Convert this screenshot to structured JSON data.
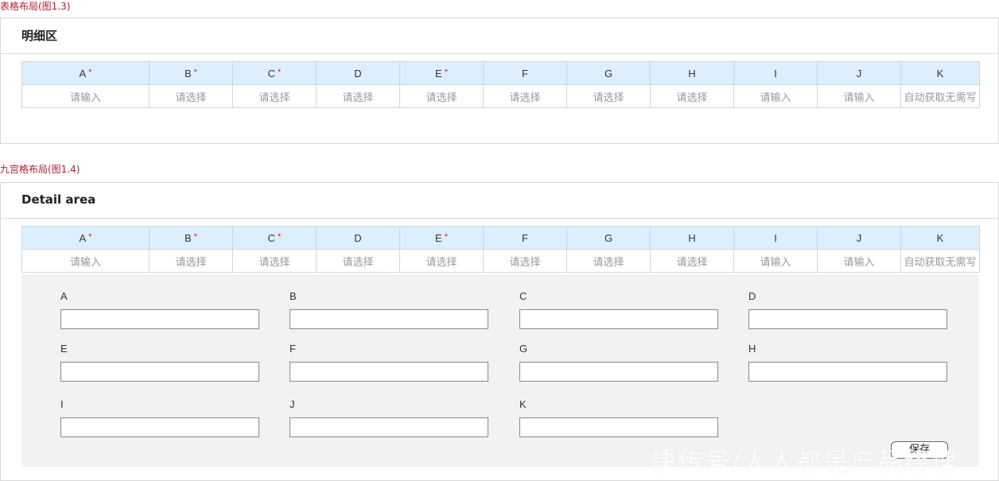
{
  "captions": {
    "table_layout": "表格布局(图1.3)",
    "grid_layout": "九宫格布局(图1.4)"
  },
  "panel1": {
    "title": "明细区"
  },
  "panel2": {
    "title": "Detail area"
  },
  "columns": [
    {
      "label": "A",
      "required": true
    },
    {
      "label": "B",
      "required": true
    },
    {
      "label": "C",
      "required": true
    },
    {
      "label": "D",
      "required": false
    },
    {
      "label": "E",
      "required": true
    },
    {
      "label": "F",
      "required": false
    },
    {
      "label": "G",
      "required": false
    },
    {
      "label": "H",
      "required": false
    },
    {
      "label": "I",
      "required": false
    },
    {
      "label": "J",
      "required": false
    },
    {
      "label": "K",
      "required": false
    }
  ],
  "required_mark": "*",
  "row_placeholders": [
    "请输入",
    "请选择",
    "请选择",
    "请选择",
    "请选择",
    "请选择",
    "请选择",
    "请选择",
    "请输入",
    "请输入",
    "自动获取无需写"
  ],
  "form_fields": [
    "A",
    "B",
    "C",
    "D",
    "E",
    "F",
    "G",
    "H",
    "I",
    "J",
    "K"
  ],
  "save_label": "保存",
  "watermark": "快传号/人人都是产品经理",
  "colors": {
    "caption": "#b01e2f",
    "header_bg": "#ddeefc",
    "required": "#e02020",
    "form_bg": "#f2f2f2"
  }
}
